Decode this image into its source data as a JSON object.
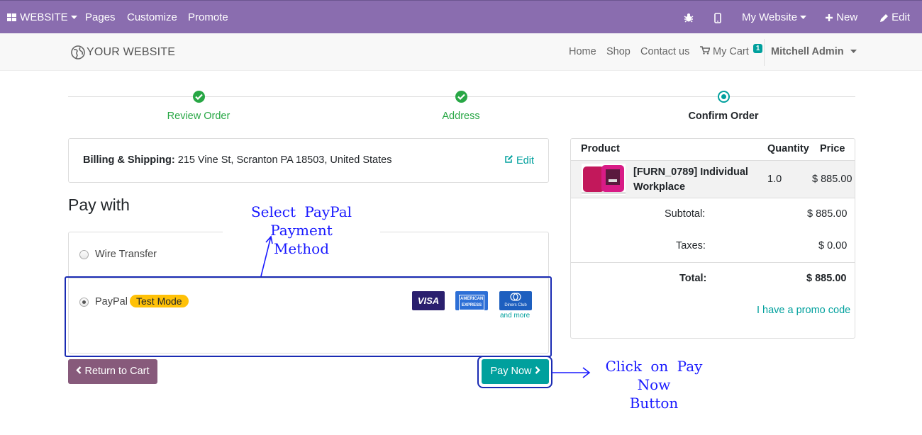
{
  "admin_bar": {
    "website_menu": "WEBSITE",
    "pages": "Pages",
    "customize": "Customize",
    "promote": "Promote",
    "site_switcher": "My Website",
    "new_label": "New",
    "edit_label": "Edit"
  },
  "header": {
    "logo_text": "YOUR WEBSITE",
    "nav": [
      "Home",
      "Shop",
      "Contact us"
    ],
    "cart_label": "My Cart",
    "cart_count": "1",
    "user": "Mitchell Admin"
  },
  "wizard": {
    "steps": [
      {
        "label": "Review Order",
        "state": "done"
      },
      {
        "label": "Address",
        "state": "done"
      },
      {
        "label": "Confirm Order",
        "state": "current"
      }
    ]
  },
  "billing": {
    "label": "Billing & Shipping:",
    "address": " 215 Vine St, Scranton PA 18503, United States",
    "edit_label": "Edit"
  },
  "payment": {
    "heading": "Pay with",
    "options": [
      {
        "label": "Wire Transfer",
        "selected": false
      },
      {
        "label": "PayPal",
        "selected": true,
        "badge": "Test Mode"
      }
    ],
    "cards": [
      "VISA",
      "AMERICAN EXPRESS",
      "Diners Club"
    ],
    "and_more": "and more"
  },
  "buttons": {
    "return": "Return to Cart",
    "pay_now": "Pay Now"
  },
  "annotations": {
    "select_paypal": [
      "Select PayPal Payment",
      "Method"
    ],
    "click_pay_now": [
      "Click on Pay Now",
      "Button"
    ]
  },
  "summary": {
    "headers": {
      "product": "Product",
      "quantity": "Quantity",
      "price": "Price"
    },
    "product_name": "[FURN_0789] Individual Workplace",
    "quantity": "1.0",
    "price": "$ 885.00",
    "subtotal_label": "Subtotal:",
    "subtotal": "$ 885.00",
    "taxes_label": "Taxes:",
    "taxes": "$ 0.00",
    "total_label": "Total:",
    "total": "$ 885.00",
    "promo": "I have a promo code"
  },
  "colors": {
    "admin_bar": "#8a6daf",
    "primary": "#00a09d",
    "success": "#28a745",
    "secondary_btn": "#875a7b",
    "annotation": "#1a1aff",
    "badge": "#ffc107"
  }
}
